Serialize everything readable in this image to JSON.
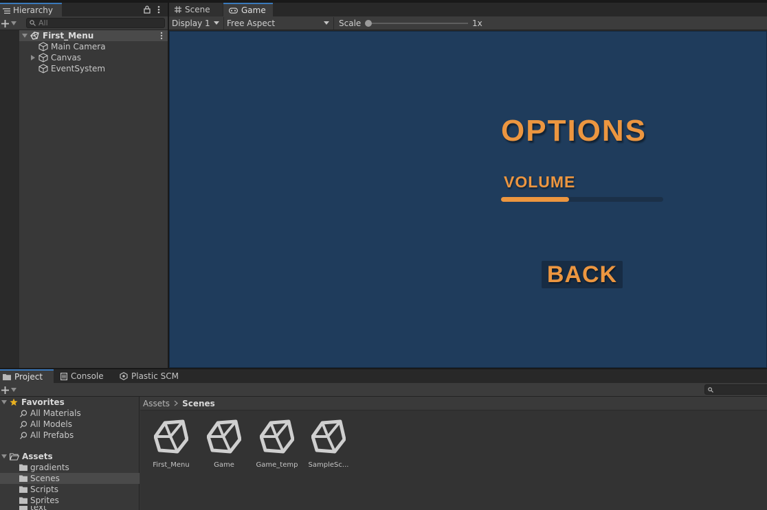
{
  "hierarchy": {
    "tab_label": "Hierarchy",
    "search_placeholder": "All",
    "scene_name": "First_Menu",
    "items": [
      {
        "label": "Main Camera"
      },
      {
        "label": "Canvas"
      },
      {
        "label": "EventSystem"
      }
    ]
  },
  "game_panel": {
    "tabs": [
      {
        "label": "Scene"
      },
      {
        "label": "Game"
      }
    ],
    "display": "Display 1",
    "aspect": "Free Aspect",
    "scale_label": "Scale",
    "scale_value": "1x",
    "view": {
      "title": "OPTIONS",
      "volume_label": "VOLUME",
      "volume_fraction": 0.42,
      "back_label": "BACK",
      "accent_color": "#ec9640",
      "background_color": "#1f3c5c"
    }
  },
  "project_panel": {
    "tabs": [
      {
        "label": "Project"
      },
      {
        "label": "Console"
      },
      {
        "label": "Plastic SCM"
      }
    ],
    "favorites": {
      "label": "Favorites",
      "items": [
        {
          "label": "All Materials"
        },
        {
          "label": "All Models"
        },
        {
          "label": "All Prefabs"
        }
      ]
    },
    "assets": {
      "label": "Assets",
      "folders": [
        {
          "label": "gradients"
        },
        {
          "label": "Scenes"
        },
        {
          "label": "Scripts"
        },
        {
          "label": "Sprites"
        },
        {
          "label": "text"
        }
      ]
    },
    "breadcrumb": {
      "root": "Assets",
      "current": "Scenes"
    },
    "scene_assets": [
      {
        "name": "First_Menu"
      },
      {
        "name": "Game"
      },
      {
        "name": "Game_temp"
      },
      {
        "name": "SampleSc..."
      }
    ]
  }
}
